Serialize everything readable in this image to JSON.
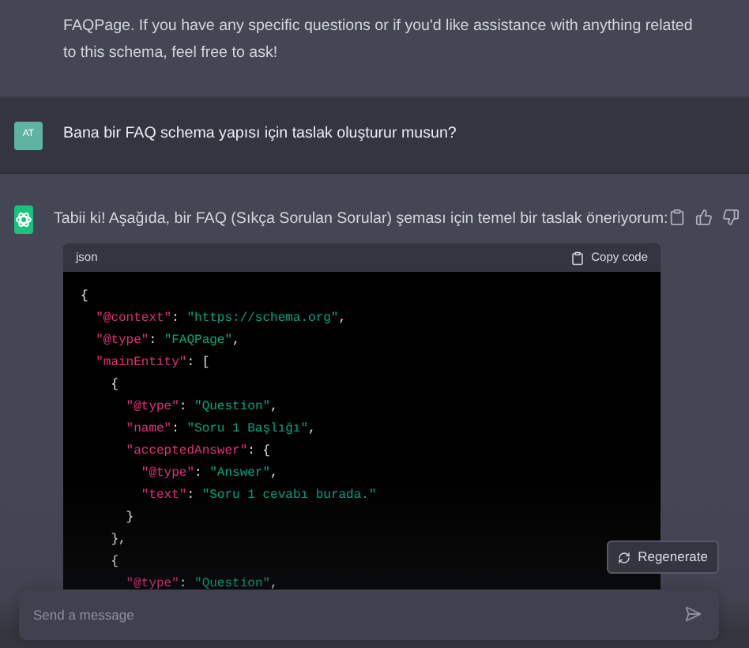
{
  "previous_reply": {
    "text": "FAQPage. If you have any specific questions or if you'd like assistance with anything related to this schema, feel free to ask!"
  },
  "user_message": {
    "avatar": "AT",
    "text": "Bana bir FAQ schema yapısı için taslak oluşturur musun?"
  },
  "reply": {
    "text": "Tabii ki! Aşağıda, bir FAQ (Sıkça Sorulan Sorular) şeması için temel bir taslak öneriyorum:",
    "code_block": {
      "language": "json",
      "copy_label": "Copy code",
      "lines": [
        [
          {
            "kind": "punct",
            "text": "{"
          }
        ],
        [
          {
            "kind": "key",
            "text": "  \"@context\""
          },
          {
            "kind": "punct",
            "text": ": "
          },
          {
            "kind": "string",
            "text": "\"https://schema.org\""
          },
          {
            "kind": "punct",
            "text": ","
          }
        ],
        [
          {
            "kind": "key",
            "text": "  \"@type\""
          },
          {
            "kind": "punct",
            "text": ": "
          },
          {
            "kind": "string",
            "text": "\"FAQPage\""
          },
          {
            "kind": "punct",
            "text": ","
          }
        ],
        [
          {
            "kind": "key",
            "text": "  \"mainEntity\""
          },
          {
            "kind": "punct",
            "text": ": ["
          }
        ],
        [
          {
            "kind": "punct",
            "text": "    {"
          }
        ],
        [
          {
            "kind": "key",
            "text": "      \"@type\""
          },
          {
            "kind": "punct",
            "text": ": "
          },
          {
            "kind": "string",
            "text": "\"Question\""
          },
          {
            "kind": "punct",
            "text": ","
          }
        ],
        [
          {
            "kind": "key",
            "text": "      \"name\""
          },
          {
            "kind": "punct",
            "text": ": "
          },
          {
            "kind": "string",
            "text": "\"Soru 1 Başlığı\""
          },
          {
            "kind": "punct",
            "text": ","
          }
        ],
        [
          {
            "kind": "key",
            "text": "      \"acceptedAnswer\""
          },
          {
            "kind": "punct",
            "text": ": {"
          }
        ],
        [
          {
            "kind": "key",
            "text": "        \"@type\""
          },
          {
            "kind": "punct",
            "text": ": "
          },
          {
            "kind": "string",
            "text": "\"Answer\""
          },
          {
            "kind": "punct",
            "text": ","
          }
        ],
        [
          {
            "kind": "key",
            "text": "        \"text\""
          },
          {
            "kind": "punct",
            "text": ": "
          },
          {
            "kind": "string",
            "text": "\"Soru 1 cevabı burada.\""
          }
        ],
        [
          {
            "kind": "punct",
            "text": "      }"
          }
        ],
        [
          {
            "kind": "punct",
            "text": "    },"
          }
        ],
        [
          {
            "kind": "punct",
            "text": "    {"
          }
        ],
        [
          {
            "kind": "key",
            "text": "      \"@type\""
          },
          {
            "kind": "punct",
            "text": ": "
          },
          {
            "kind": "string",
            "text": "\"Question\""
          },
          {
            "kind": "punct",
            "text": ","
          }
        ]
      ]
    }
  },
  "regenerate_button": "Regenerate",
  "composer": {
    "placeholder": "Send a message"
  }
}
